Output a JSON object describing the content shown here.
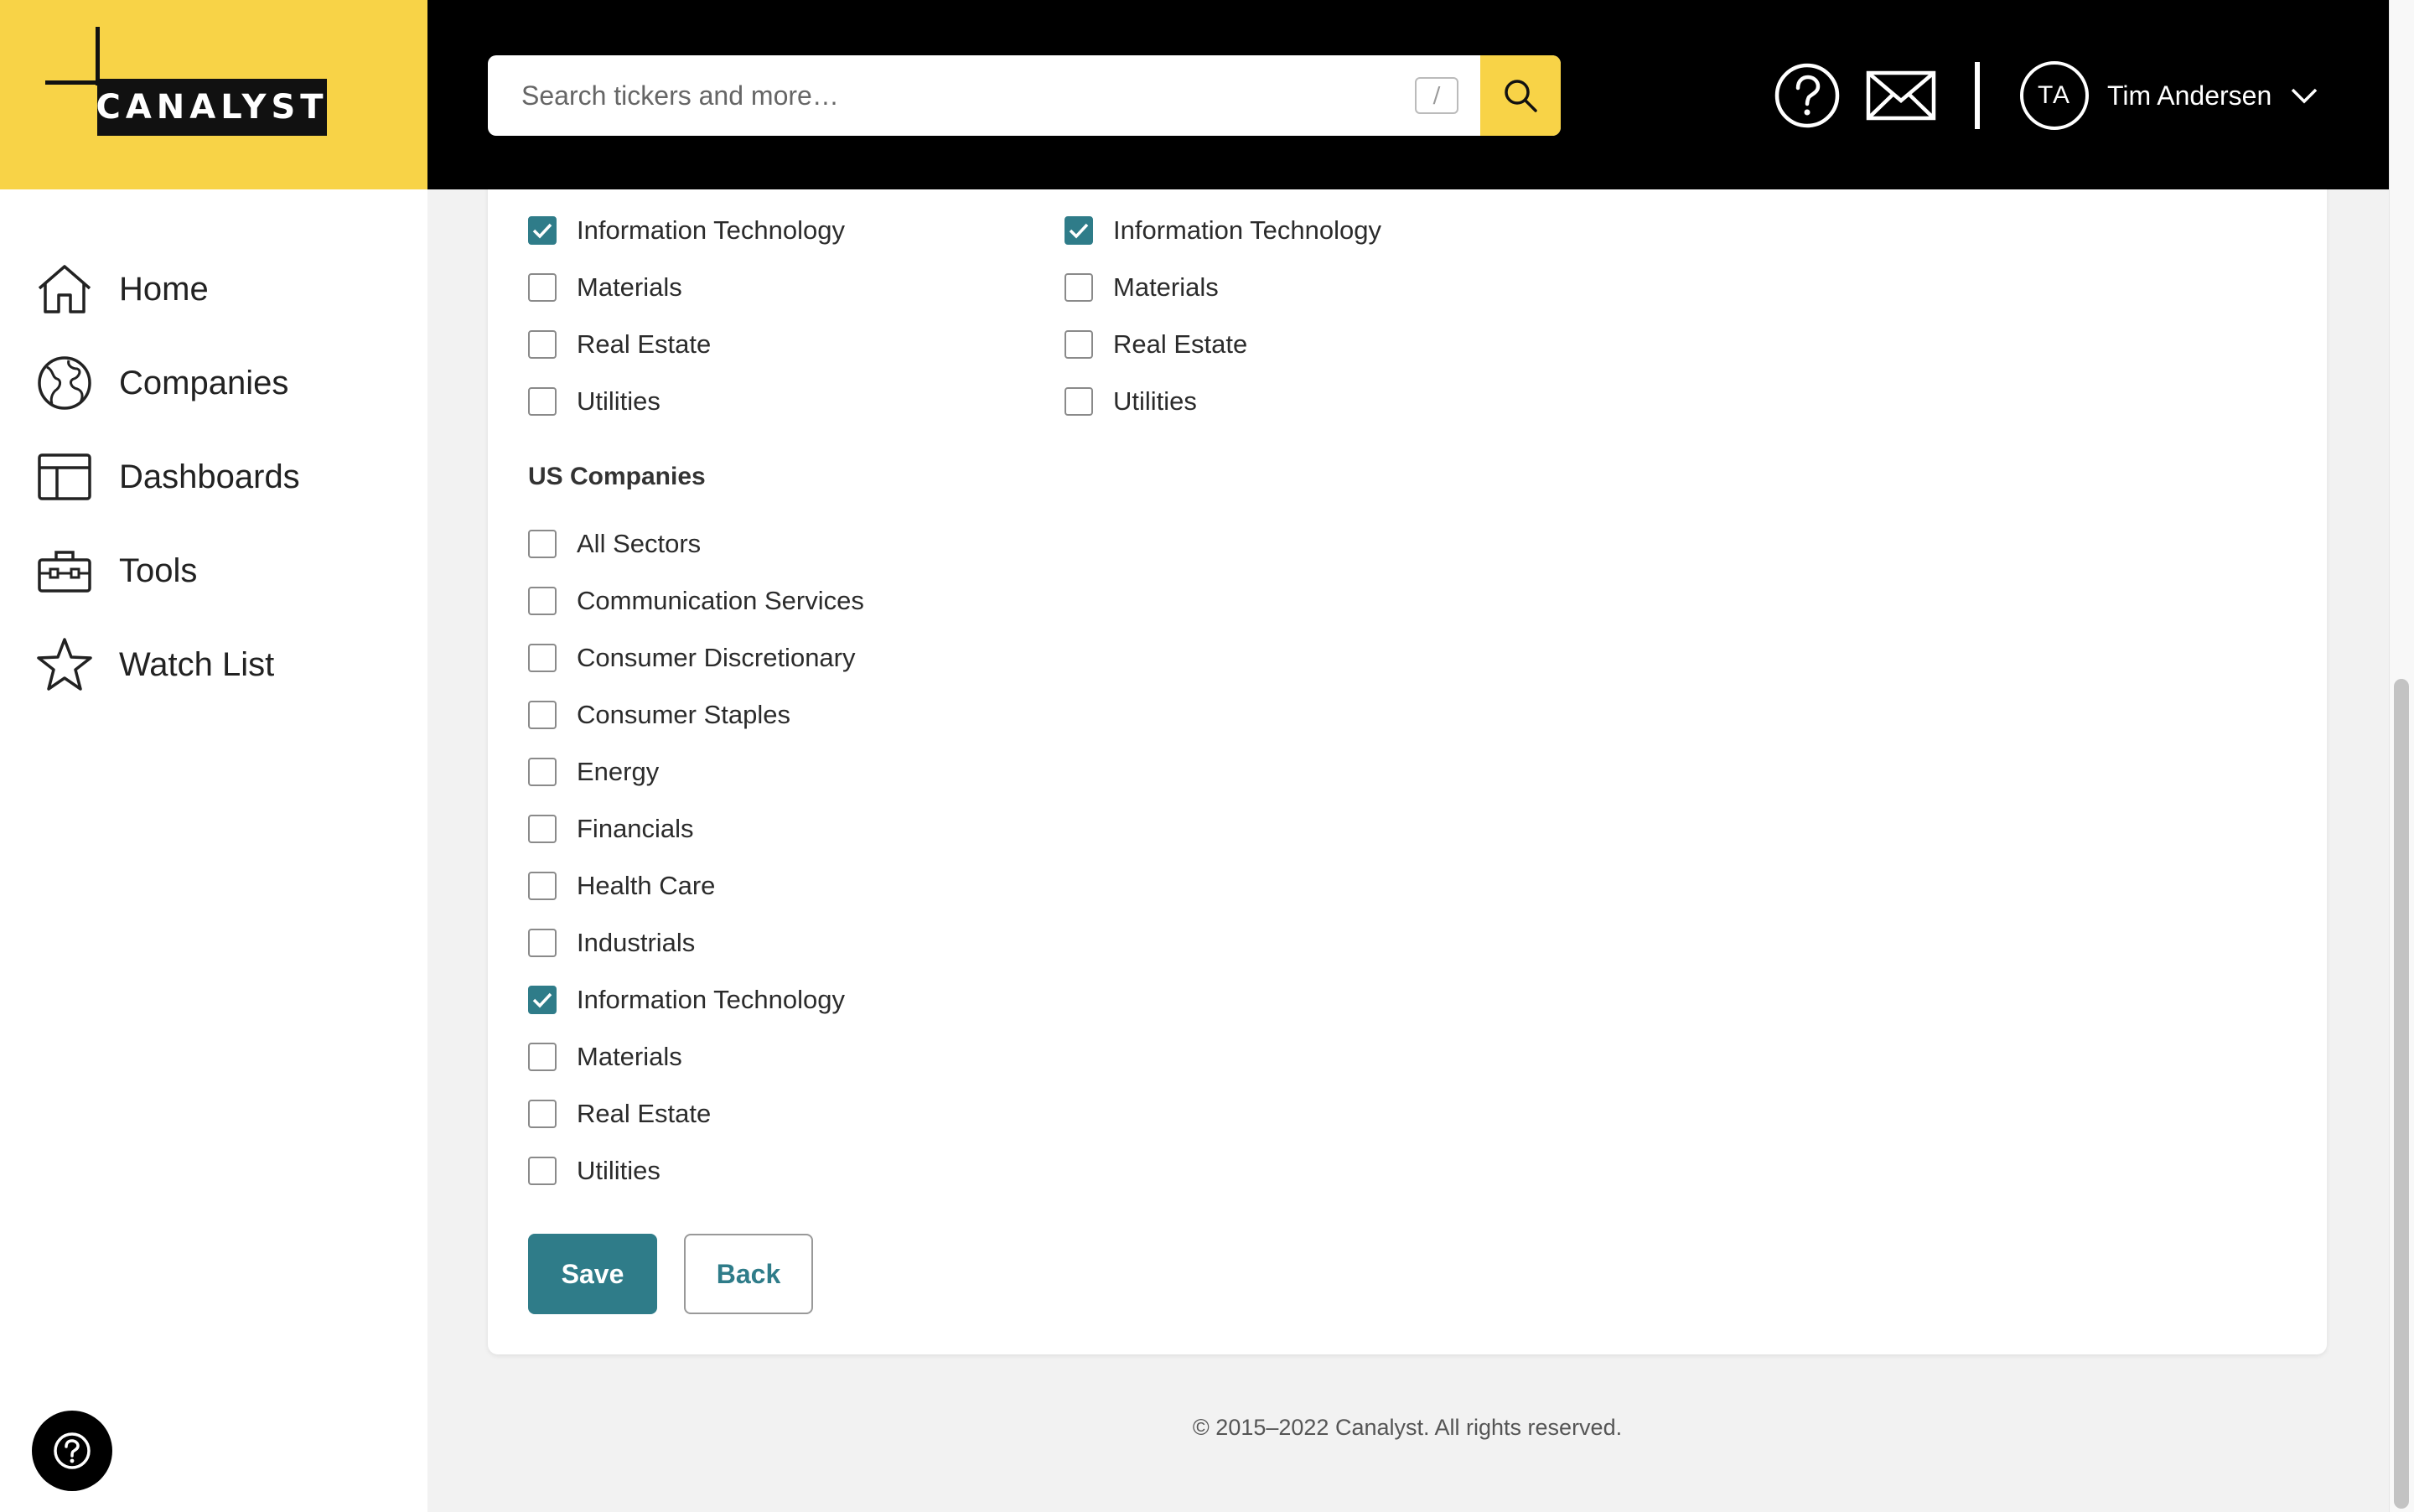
{
  "brand": {
    "logo_text": "CANALYST",
    "accent": "#f8d347",
    "primary": "#2f7c89"
  },
  "search": {
    "placeholder": "Search tickers and more…",
    "shortcut": "/"
  },
  "user": {
    "initials": "TA",
    "name": "Tim Andersen"
  },
  "nav": [
    {
      "label": "Home",
      "icon": "home-icon"
    },
    {
      "label": "Companies",
      "icon": "globe-icon"
    },
    {
      "label": "Dashboards",
      "icon": "dashboard-icon"
    },
    {
      "label": "Tools",
      "icon": "toolbox-icon"
    },
    {
      "label": "Watch List",
      "icon": "star-icon"
    }
  ],
  "upper_left": [
    {
      "label": "Information Technology",
      "checked": true
    },
    {
      "label": "Materials",
      "checked": false
    },
    {
      "label": "Real Estate",
      "checked": false
    },
    {
      "label": "Utilities",
      "checked": false
    }
  ],
  "upper_right": [
    {
      "label": "Information Technology",
      "checked": true
    },
    {
      "label": "Materials",
      "checked": false
    },
    {
      "label": "Real Estate",
      "checked": false
    },
    {
      "label": "Utilities",
      "checked": false
    }
  ],
  "us_companies": {
    "title": "US Companies",
    "items": [
      {
        "label": "All Sectors",
        "checked": false
      },
      {
        "label": "Communication Services",
        "checked": false
      },
      {
        "label": "Consumer Discretionary",
        "checked": false
      },
      {
        "label": "Consumer Staples",
        "checked": false
      },
      {
        "label": "Energy",
        "checked": false
      },
      {
        "label": "Financials",
        "checked": false
      },
      {
        "label": "Health Care",
        "checked": false
      },
      {
        "label": "Industrials",
        "checked": false
      },
      {
        "label": "Information Technology",
        "checked": true
      },
      {
        "label": "Materials",
        "checked": false
      },
      {
        "label": "Real Estate",
        "checked": false
      },
      {
        "label": "Utilities",
        "checked": false
      }
    ]
  },
  "actions": {
    "save": "Save",
    "back": "Back"
  },
  "footer": "© 2015–2022 Canalyst. All rights reserved."
}
